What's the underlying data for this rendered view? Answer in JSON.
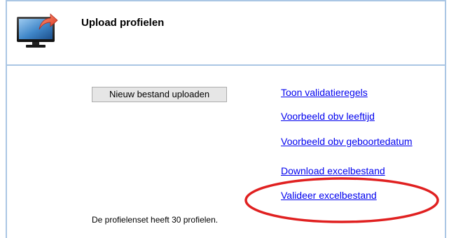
{
  "page": {
    "title": "Upload profielen"
  },
  "actions": {
    "upload_button_label": "Nieuw bestand uploaden"
  },
  "links": [
    {
      "label": "Toon validatieregels"
    },
    {
      "label": "Voorbeeld obv leeftijd"
    },
    {
      "label": "Voorbeeld obv geboortedatum"
    },
    {
      "label": "Download excelbestand"
    },
    {
      "label": "Valideer excelbestand"
    }
  ],
  "status": {
    "profile_count_text": "De profielenset heeft 30 profielen."
  },
  "icons": {
    "header_icon": "monitor-with-arrow-icon"
  },
  "colors": {
    "frame_border": "#aac6e4",
    "link": "#0000ee",
    "highlight": "#e02020"
  }
}
